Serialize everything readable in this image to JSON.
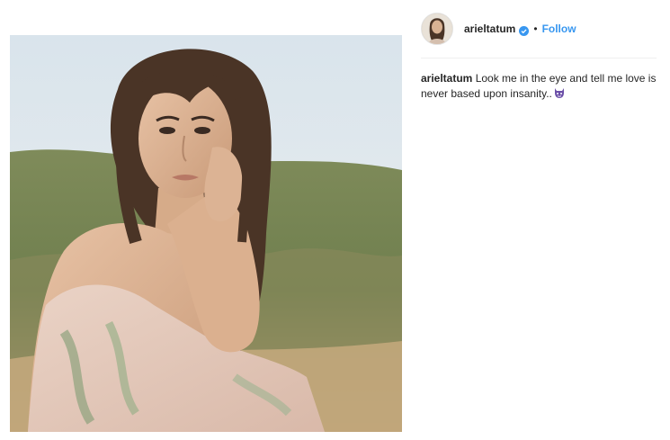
{
  "post": {
    "username": "arieltatum",
    "separator": "•",
    "follow_label": "Follow",
    "caption_user": "arieltatum",
    "caption_text": " Look me in the eye and tell me love is never based upon insanity..",
    "photo_icon": "portrait-photo",
    "verified_icon": "verified-badge-icon",
    "emoji_icon": "purple-devil-emoji-icon"
  },
  "colors": {
    "follow": "#3897f0",
    "verified": "#3897f0",
    "text": "#262626",
    "divider": "#efefef"
  }
}
